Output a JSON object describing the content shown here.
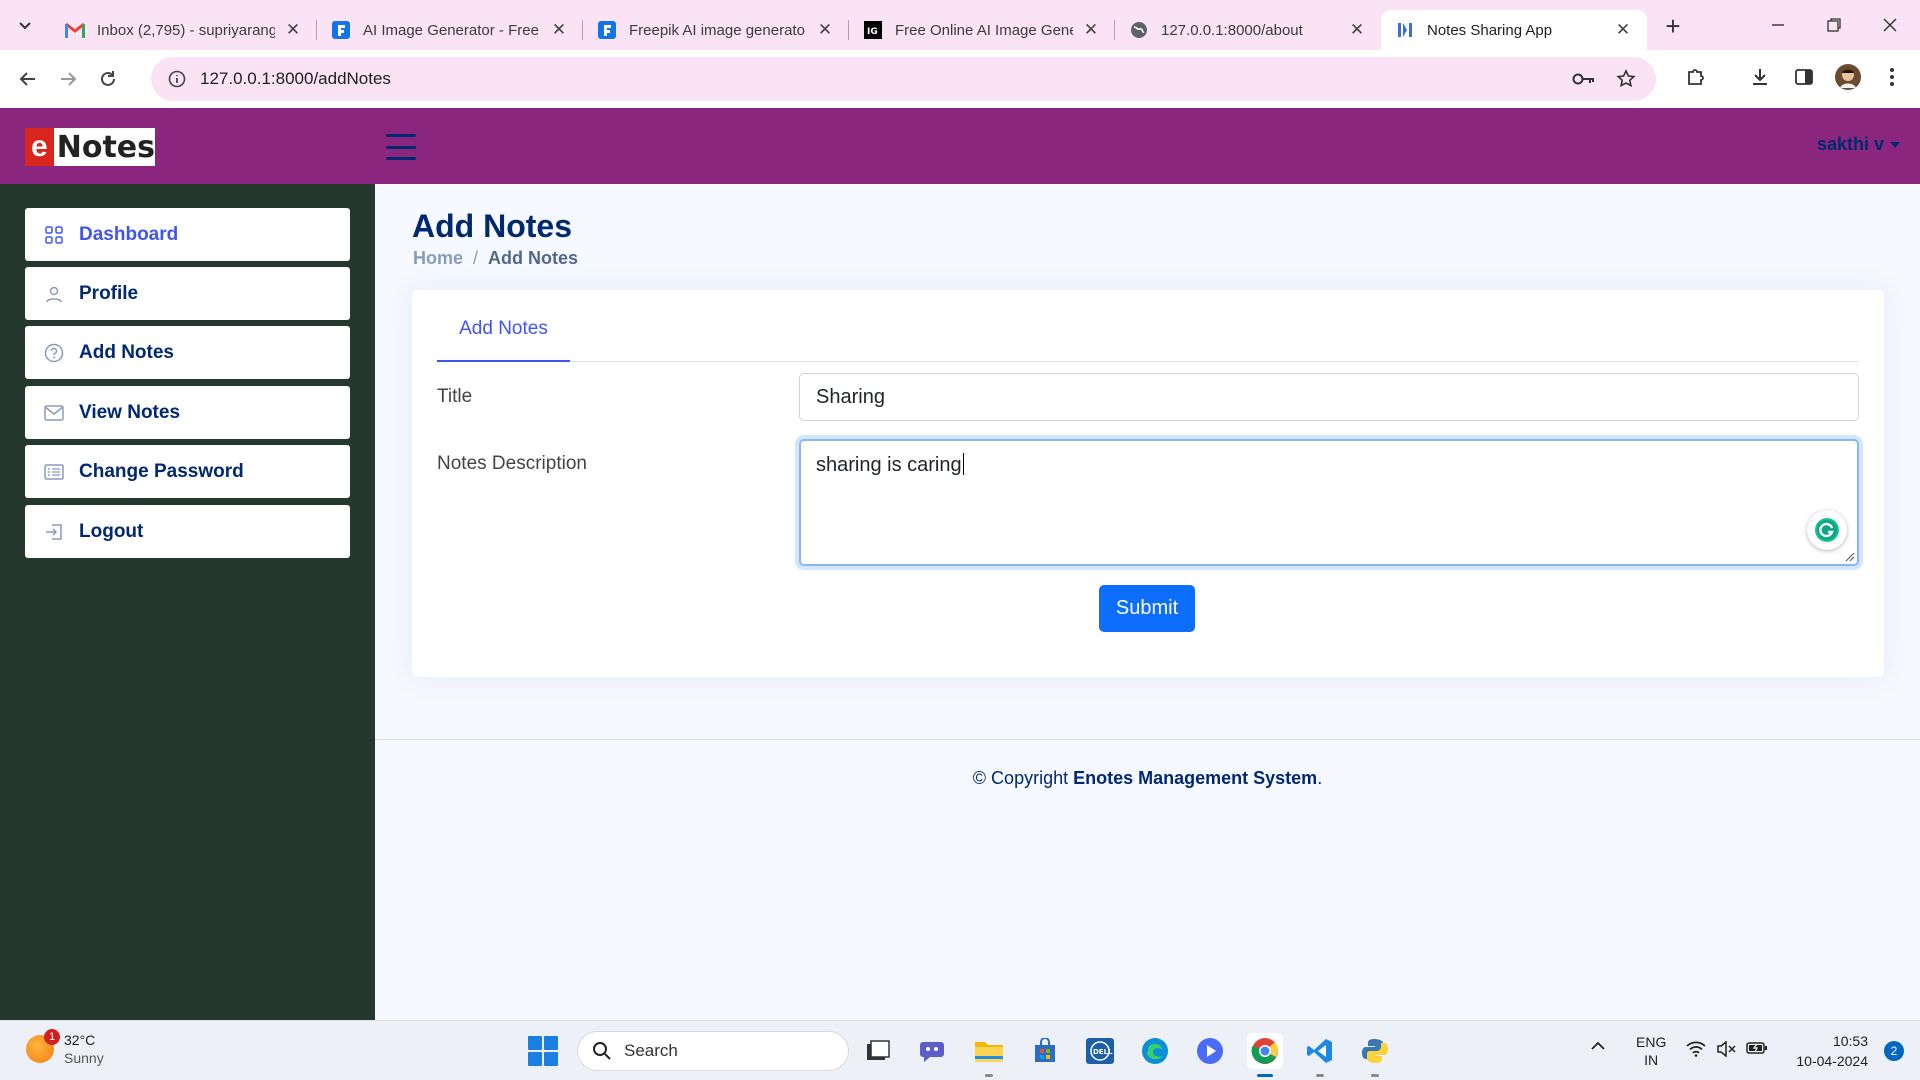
{
  "browser": {
    "tabs": [
      {
        "label": "Inbox (2,795) - supriyarang",
        "icon": "gmail-icon",
        "active": false
      },
      {
        "label": "AI Image Generator - Free",
        "icon": "freepik-icon",
        "active": false
      },
      {
        "label": "Freepik AI image generato",
        "icon": "freepik-icon",
        "active": false
      },
      {
        "label": "Free Online AI Image Gene",
        "icon": "ig-icon",
        "active": false
      },
      {
        "label": "127.0.0.1:8000/about",
        "icon": "globe-icon",
        "active": false
      },
      {
        "label": "Notes Sharing App",
        "icon": "app-favicon-icon",
        "active": true
      }
    ],
    "url": "127.0.0.1:8000/addNotes"
  },
  "header": {
    "logo_letter": "e",
    "logo_rest": "Notes",
    "user_name": "sakthi v"
  },
  "sidebar": {
    "items": [
      {
        "label": "Dashboard",
        "icon": "grid-icon",
        "active": true
      },
      {
        "label": "Profile",
        "icon": "person-icon",
        "active": false
      },
      {
        "label": "Add Notes",
        "icon": "question-circle-icon",
        "active": false
      },
      {
        "label": "View Notes",
        "icon": "envelope-icon",
        "active": false
      },
      {
        "label": "Change Password",
        "icon": "card-list-icon",
        "active": false
      },
      {
        "label": "Logout",
        "icon": "box-arrow-in-right-icon",
        "active": false
      }
    ]
  },
  "main": {
    "title": "Add Notes",
    "breadcrumb": {
      "home": "Home",
      "separator": "/",
      "current": "Add Notes"
    },
    "tab_label": "Add Notes",
    "form": {
      "title_label": "Title",
      "title_value": "Sharing",
      "description_label": "Notes Description",
      "description_value": "sharing is caring",
      "submit_label": "Submit"
    }
  },
  "footer": {
    "prefix": "© Copyright ",
    "brand": "Enotes Management System",
    "suffix": "."
  },
  "taskbar": {
    "weather_temp": "32°C",
    "weather_cond": "Sunny",
    "weather_badge": "1",
    "search_placeholder": "Search",
    "lang_top": "ENG",
    "lang_bottom": "IN",
    "time": "10:53",
    "date": "10-04-2024",
    "notification_count": "2"
  },
  "colors": {
    "header_bg": "#8b267e",
    "sidebar_bg": "#25382f",
    "primary_text": "#012970",
    "accent": "#4154f1",
    "submit_bg": "#0d6efd",
    "tabstrip_bg": "#f9e3f4"
  }
}
